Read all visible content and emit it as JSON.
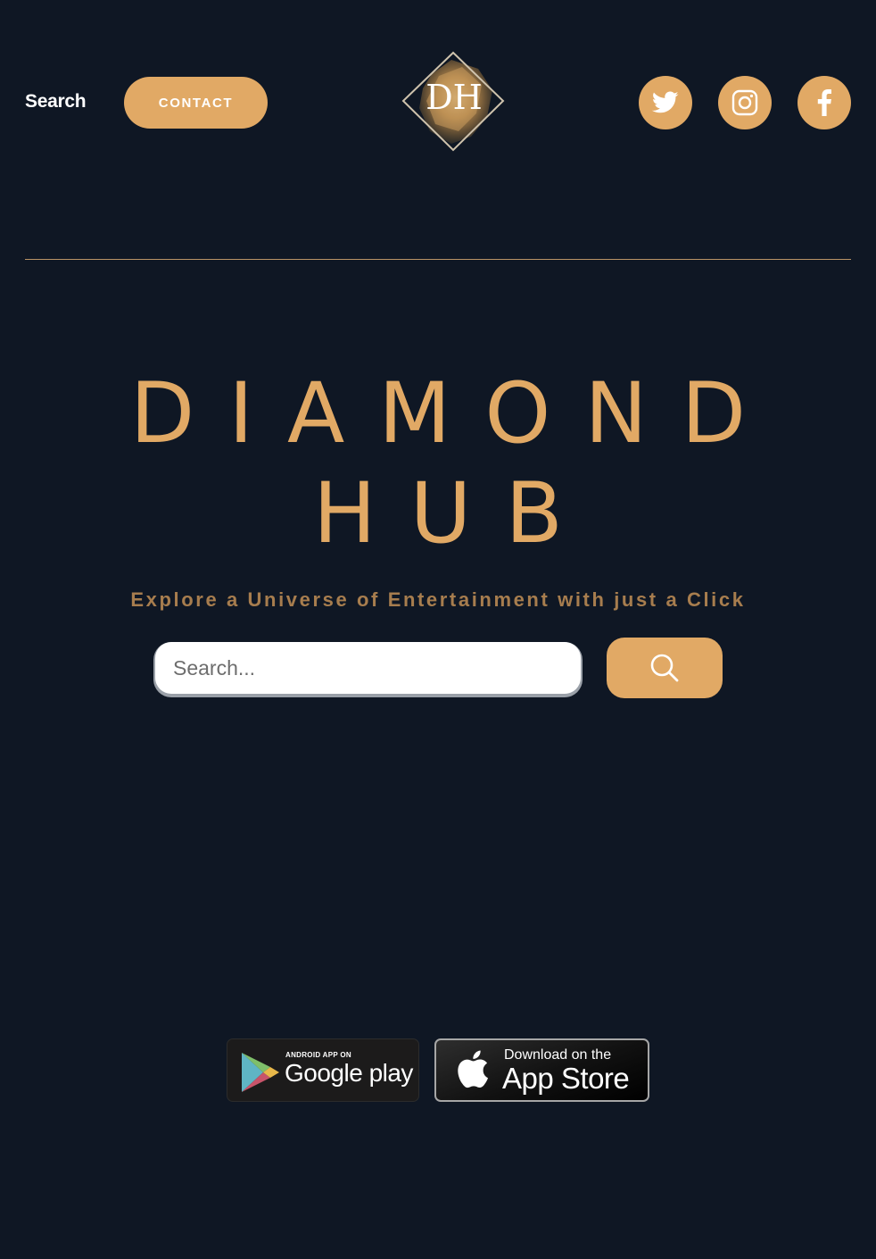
{
  "header": {
    "search_link": "Search",
    "contact_button": "CONTACT",
    "logo_text": "DH",
    "social": [
      "twitter-icon",
      "instagram-icon",
      "facebook-icon"
    ]
  },
  "hero": {
    "title_line1": "DIAMOND",
    "title_line2": "HUB",
    "tagline": "Explore a Universe of Entertainment with just a Click"
  },
  "search": {
    "placeholder": "Search..."
  },
  "badges": {
    "google_small": "ANDROID APP ON",
    "google_big": "Google play",
    "apple_small": "Download on the",
    "apple_big": "App Store"
  },
  "colors": {
    "background": "#0f1724",
    "accent": "#e1a965",
    "tagline": "#a77d4e",
    "divider": "#b99365"
  }
}
